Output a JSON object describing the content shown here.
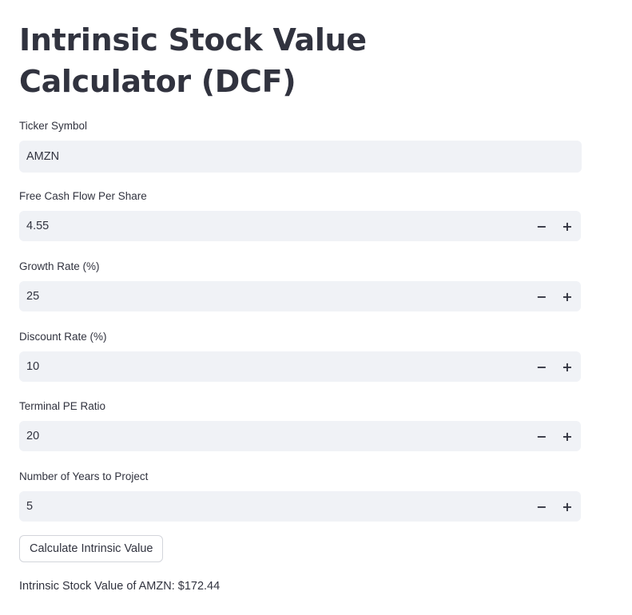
{
  "title": "Intrinsic Stock Value Calculator (DCF)",
  "fields": [
    {
      "label": "Ticker Symbol",
      "value": "AMZN",
      "type": "text"
    },
    {
      "label": "Free Cash Flow Per Share",
      "value": "4.55",
      "type": "number"
    },
    {
      "label": "Growth Rate (%)",
      "value": "25",
      "type": "number"
    },
    {
      "label": "Discount Rate (%)",
      "value": "10",
      "type": "number"
    },
    {
      "label": "Terminal PE Ratio",
      "value": "20",
      "type": "number"
    },
    {
      "label": "Number of Years to Project",
      "value": "5",
      "type": "number"
    }
  ],
  "stepper": {
    "minus": "−",
    "plus": "+"
  },
  "button": {
    "label": "Calculate Intrinsic Value"
  },
  "result": {
    "text": "Intrinsic Stock Value of AMZN: $172.44"
  }
}
